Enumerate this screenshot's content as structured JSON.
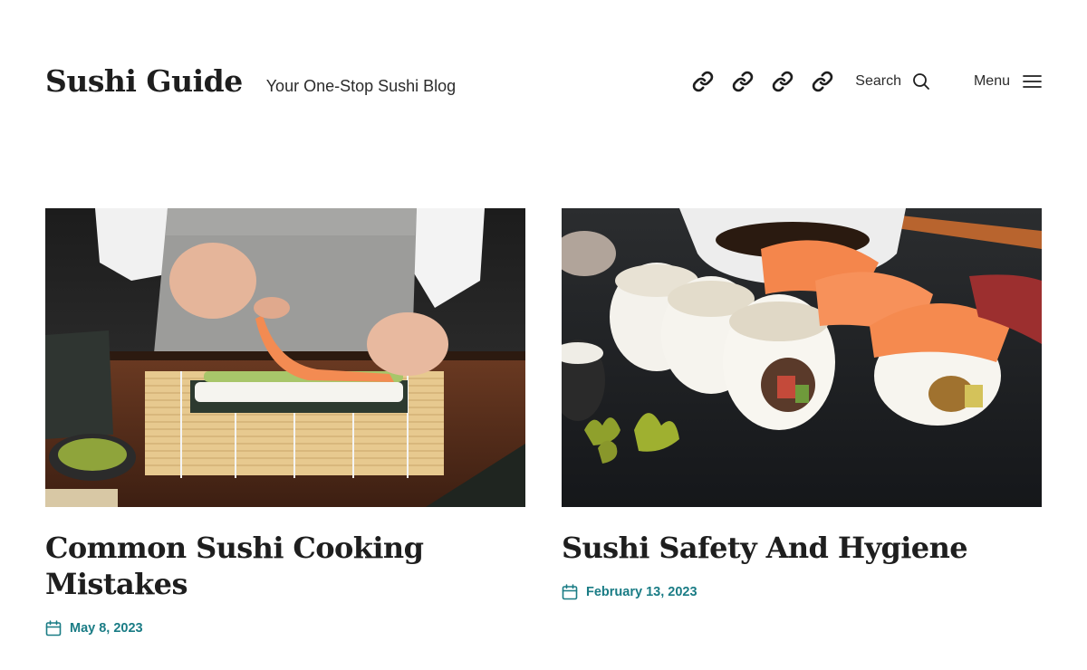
{
  "header": {
    "site_title": "Sushi Guide",
    "tagline": "Your One-Stop Sushi Blog",
    "social_links": [
      {
        "icon": "link-icon"
      },
      {
        "icon": "link-icon"
      },
      {
        "icon": "link-icon"
      },
      {
        "icon": "link-icon"
      }
    ],
    "search_label": "Search",
    "menu_label": "Menu"
  },
  "posts": [
    {
      "title": "Common Sushi Cooking Mistakes",
      "date": "May 8, 2023",
      "image": "photo of hands rolling salmon sushi on a bamboo mat"
    },
    {
      "title": "Sushi Safety And Hygiene",
      "date": "February 13, 2023",
      "image": "photo of sesame-topped sushi rolls and salmon nigiri on slate"
    }
  ],
  "colors": {
    "text": "#1e1e1e",
    "accent": "#1a7c85",
    "background": "#ffffff"
  }
}
